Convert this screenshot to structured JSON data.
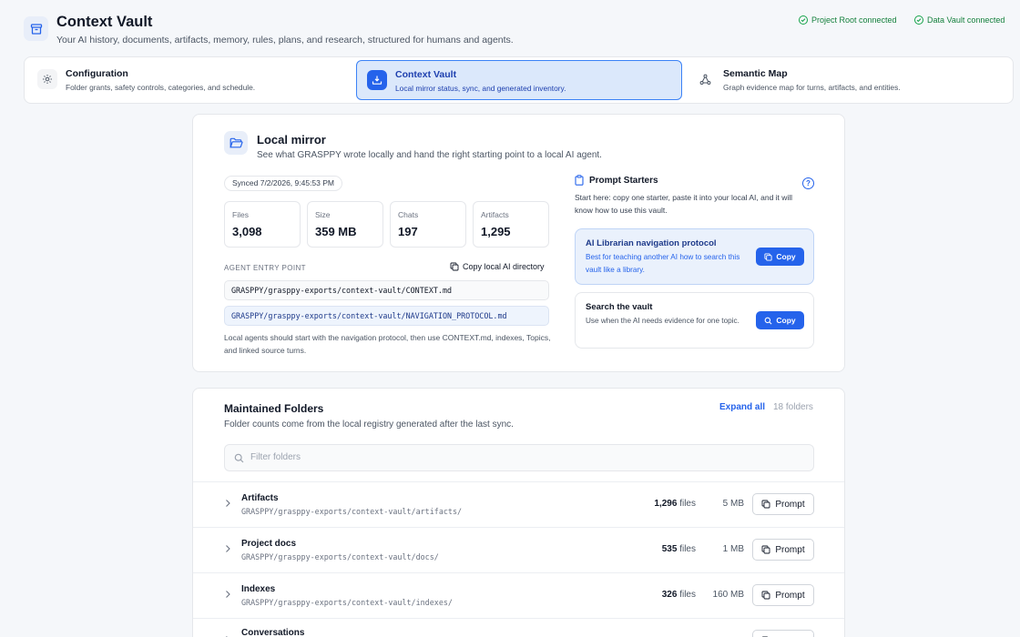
{
  "app": {
    "title": "Context Vault",
    "subtitle": "Your AI history, documents, artifacts, memory, rules, plans, and research, structured for humans and agents."
  },
  "status": [
    {
      "label": "Project Root connected"
    },
    {
      "label": "Data Vault connected"
    }
  ],
  "tabs": [
    {
      "title": "Configuration",
      "desc": "Folder grants, safety controls, categories, and schedule.",
      "icon": "gear-icon",
      "active": false
    },
    {
      "title": "Context Vault",
      "desc": "Local mirror status, sync, and generated inventory.",
      "icon": "download-icon",
      "active": true
    },
    {
      "title": "Semantic Map",
      "desc": "Graph evidence map for turns, artifacts, and entities.",
      "icon": "graph-icon",
      "active": false
    }
  ],
  "mirror": {
    "title": "Local mirror",
    "subtitle": "See what GRASPPY wrote locally and hand the right starting point to a local AI agent.",
    "synced": "Synced 7/2/2026, 9:45:53 PM",
    "stats": [
      {
        "label": "Files",
        "value": "3,098"
      },
      {
        "label": "Size",
        "value": "359 MB"
      },
      {
        "label": "Chats",
        "value": "197"
      },
      {
        "label": "Artifacts",
        "value": "1,295"
      }
    ],
    "entry_label": "AGENT ENTRY POINT",
    "copy_dir_label": "Copy local AI directory",
    "paths": [
      "GRASPPY/grasppy-exports/context-vault/CONTEXT.md",
      "GRASPPY/grasppy-exports/context-vault/NAVIGATION_PROTOCOL.md"
    ],
    "note": "Local agents should start with the navigation protocol, then use CONTEXT.md, indexes, Topics, and linked source turns."
  },
  "prompt_starters": {
    "title": "Prompt Starters",
    "help": "?",
    "desc": "Start here: copy one starter, paste it into your local AI, and it will know how to use this vault.",
    "cards": [
      {
        "title": "AI Librarian navigation protocol",
        "desc": "Best for teaching another AI how to search this vault like a library.",
        "button": "Copy"
      },
      {
        "title": "Search the vault",
        "desc": "Use when the AI needs evidence for one topic.",
        "button": "Copy"
      }
    ]
  },
  "folders": {
    "title": "Maintained Folders",
    "subtitle": "Folder counts come from the local registry generated after the last sync.",
    "expand_label": "Expand all",
    "count_label": "18 folders",
    "filter_placeholder": "Filter folders",
    "files_suffix": "files",
    "prompt_label": "Prompt",
    "rows": [
      {
        "name": "Artifacts",
        "path": "GRASPPY/grasppy-exports/context-vault/artifacts/",
        "files": "1,296",
        "size": "5 MB"
      },
      {
        "name": "Project docs",
        "path": "GRASPPY/grasppy-exports/context-vault/docs/",
        "files": "535",
        "size": "1 MB"
      },
      {
        "name": "Indexes",
        "path": "GRASPPY/grasppy-exports/context-vault/indexes/",
        "files": "326",
        "size": "160 MB"
      },
      {
        "name": "Conversations",
        "path": "",
        "files": "",
        "size": ""
      }
    ]
  },
  "colors": {
    "accent": "#2563eb",
    "success": "#16a34a",
    "background": "#f5f7fa"
  }
}
